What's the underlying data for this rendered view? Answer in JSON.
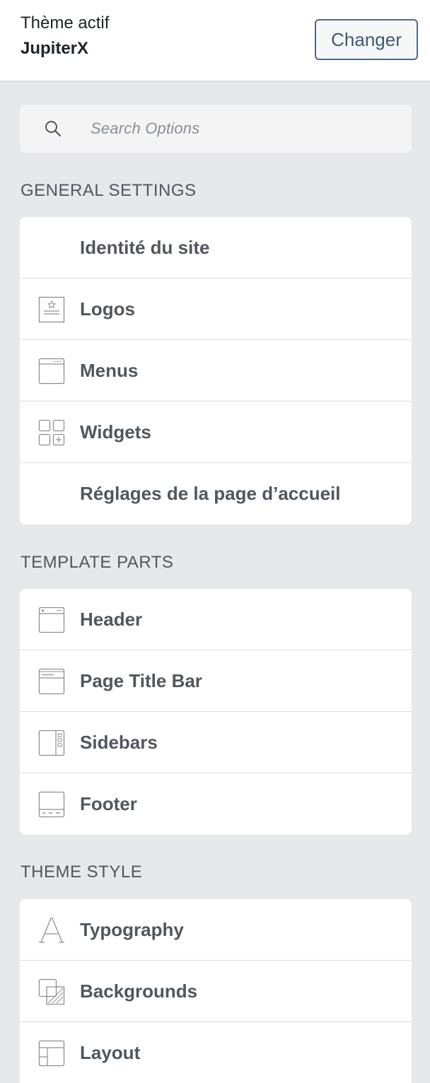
{
  "header": {
    "active_theme_label": "Thème actif",
    "theme_name": "JupiterX",
    "change_button": "Changer"
  },
  "search": {
    "placeholder": "Search Options",
    "icon": "search-icon"
  },
  "sections": [
    {
      "title": "GENERAL SETTINGS",
      "items": [
        {
          "label": "Identité du site",
          "icon": ""
        },
        {
          "label": "Logos",
          "icon": "logo-icon"
        },
        {
          "label": "Menus",
          "icon": "menu-window-icon"
        },
        {
          "label": "Widgets",
          "icon": "widgets-grid-icon"
        },
        {
          "label": "Réglages de la page d’accueil",
          "icon": ""
        }
      ]
    },
    {
      "title": "TEMPLATE PARTS",
      "items": [
        {
          "label": "Header",
          "icon": "header-layout-icon"
        },
        {
          "label": "Page Title Bar",
          "icon": "title-bar-icon"
        },
        {
          "label": "Sidebars",
          "icon": "sidebar-layout-icon"
        },
        {
          "label": "Footer",
          "icon": "footer-layout-icon"
        }
      ]
    },
    {
      "title": "THEME STYLE",
      "items": [
        {
          "label": "Typography",
          "icon": "typography-icon"
        },
        {
          "label": "Backgrounds",
          "icon": "backgrounds-icon"
        },
        {
          "label": "Layout",
          "icon": "layout-grid-icon"
        }
      ]
    }
  ],
  "colors": {
    "background": "#e7e8ea",
    "panel": "#ffffff",
    "text": "#50575e",
    "button_border": "#4f6b83"
  }
}
